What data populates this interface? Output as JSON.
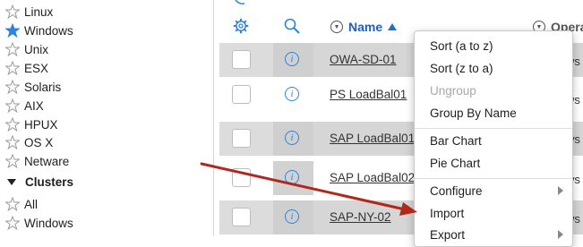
{
  "sidebar": {
    "items": [
      {
        "label": "Linux",
        "starred": false
      },
      {
        "label": "Windows",
        "starred": true
      },
      {
        "label": "Unix",
        "starred": false
      },
      {
        "label": "ESX",
        "starred": false
      },
      {
        "label": "Solaris",
        "starred": false
      },
      {
        "label": "AIX",
        "starred": false
      },
      {
        "label": "HPUX",
        "starred": false
      },
      {
        "label": "OS X",
        "starred": false
      },
      {
        "label": "Netware",
        "starred": false
      }
    ],
    "section_label": "Clusters",
    "section_items": [
      {
        "label": "All",
        "starred": false
      },
      {
        "label": "Windows",
        "starred": false
      }
    ]
  },
  "grid": {
    "header": {
      "settings_icon": "gear-icon",
      "search_icon": "search-icon",
      "name_label": "Name",
      "operating_label": "Operat",
      "sort_direction": "ascending"
    },
    "rows": [
      {
        "name": "OWA-SD-01",
        "tail": "ws"
      },
      {
        "name": "PS LoadBal01",
        "tail": "ws"
      },
      {
        "name": "SAP LoadBal01",
        "tail": "ws"
      },
      {
        "name": "SAP LoadBal02",
        "tail": "ws"
      },
      {
        "name": "SAP-NY-02",
        "tail": "ws"
      }
    ]
  },
  "context_menu": {
    "items": [
      {
        "label": "Sort (a to z)",
        "enabled": true,
        "submenu": false
      },
      {
        "label": "Sort (z to a)",
        "enabled": true,
        "submenu": false
      },
      {
        "label": "Ungroup",
        "enabled": false,
        "submenu": false
      },
      {
        "label": "Group By Name",
        "enabled": true,
        "submenu": false
      },
      {
        "label": "Bar Chart",
        "enabled": true,
        "submenu": false
      },
      {
        "label": "Pie Chart",
        "enabled": true,
        "submenu": false
      },
      {
        "label": "Configure",
        "enabled": true,
        "submenu": true
      },
      {
        "label": "Import",
        "enabled": true,
        "submenu": false
      },
      {
        "label": "Export",
        "enabled": true,
        "submenu": true
      }
    ]
  },
  "colors": {
    "accent": "#1f5fb2",
    "star_active": "#2f84d8",
    "annotation_arrow": "#b2271c"
  }
}
